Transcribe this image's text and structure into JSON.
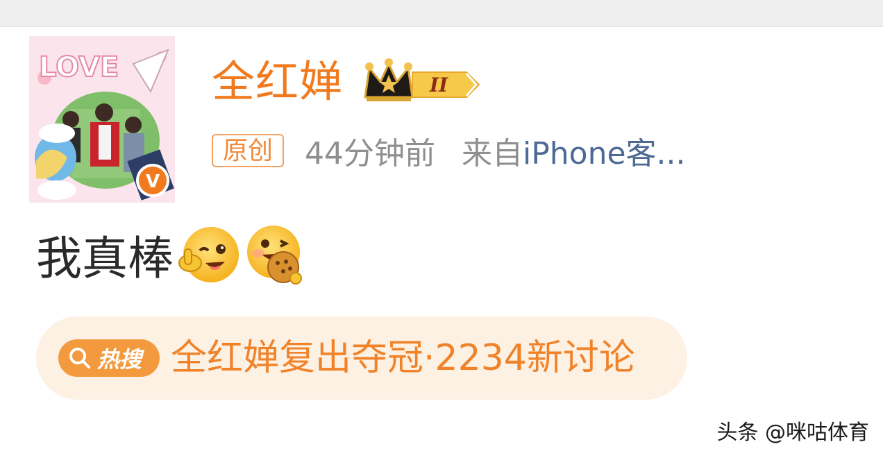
{
  "post": {
    "author_name": "全红婵",
    "member_level": "II",
    "original_tag": "原创",
    "time": "44分钟前",
    "source_prefix": "来自",
    "source": "iPhone客...",
    "body": "我真棒",
    "emojis": [
      "wink-thumbs-emoji",
      "eating-cookie-emoji"
    ],
    "avatar_text": "LOVE",
    "verified_mark": "V"
  },
  "hot_search": {
    "badge": "热搜",
    "topic": "全红婵复出夺冠·2234新讨论",
    "icon": "search-icon"
  },
  "watermark": "头条 @咪咕体育",
  "colors": {
    "accent_orange": "#f07a1d",
    "link_blue": "#4c6a93",
    "meta_gray": "#8f8f8f",
    "pill_bg": "#fdf1e3",
    "badge_orange": "#f49a3e"
  }
}
